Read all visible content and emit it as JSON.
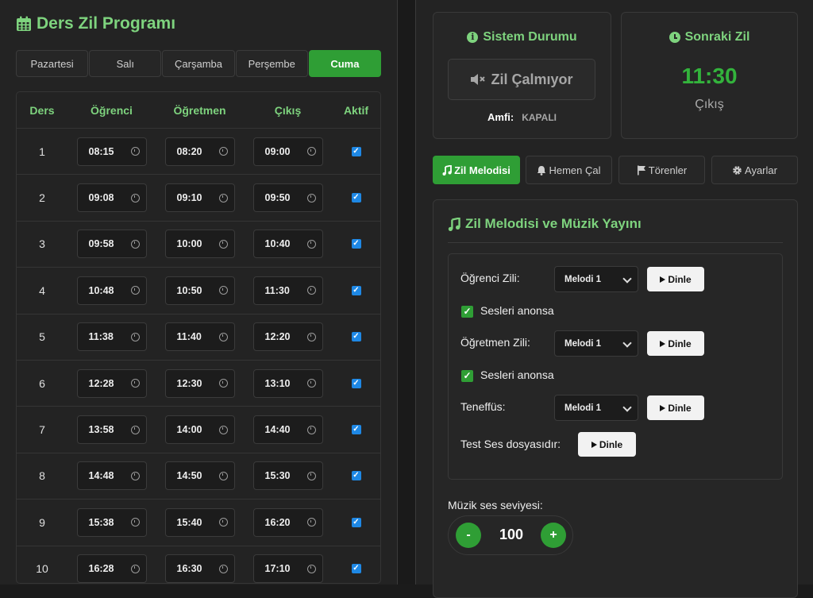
{
  "schedule": {
    "title": "Ders Zil Programı",
    "days": [
      "Pazartesi",
      "Salı",
      "Çarşamba",
      "Perşembe",
      "Cuma"
    ],
    "active_day": "Cuma",
    "columns": [
      "Ders",
      "Öğrenci",
      "Öğretmen",
      "Çıkış",
      "Aktif"
    ],
    "rows": [
      {
        "ders": "1",
        "ogrenci": "08:15",
        "ogretmen": "08:20",
        "cikis": "09:00",
        "aktif": true
      },
      {
        "ders": "2",
        "ogrenci": "09:08",
        "ogretmen": "09:10",
        "cikis": "09:50",
        "aktif": true
      },
      {
        "ders": "3",
        "ogrenci": "09:58",
        "ogretmen": "10:00",
        "cikis": "10:40",
        "aktif": true
      },
      {
        "ders": "4",
        "ogrenci": "10:48",
        "ogretmen": "10:50",
        "cikis": "11:30",
        "aktif": true
      },
      {
        "ders": "5",
        "ogrenci": "11:38",
        "ogretmen": "11:40",
        "cikis": "12:20",
        "aktif": true
      },
      {
        "ders": "6",
        "ogrenci": "12:28",
        "ogretmen": "12:30",
        "cikis": "13:10",
        "aktif": true
      },
      {
        "ders": "7",
        "ogrenci": "13:58",
        "ogretmen": "14:00",
        "cikis": "14:40",
        "aktif": true
      },
      {
        "ders": "8",
        "ogrenci": "14:48",
        "ogretmen": "14:50",
        "cikis": "15:30",
        "aktif": true
      },
      {
        "ders": "9",
        "ogrenci": "15:38",
        "ogretmen": "15:40",
        "cikis": "16:20",
        "aktif": true
      },
      {
        "ders": "10",
        "ogrenci": "16:28",
        "ogretmen": "16:30",
        "cikis": "17:10",
        "aktif": true
      }
    ]
  },
  "status": {
    "title": "Sistem Durumu",
    "bell_state": "Zil Çalmıyor",
    "amfi_label": "Amfi:",
    "amfi_value": "KAPALI"
  },
  "next_bell": {
    "title": "Sonraki Zil",
    "time": "11:30",
    "label": "Çıkış"
  },
  "nav": {
    "melody": "Zil Melodisi",
    "ring_now": "Hemen Çal",
    "ceremonies": "Törenler",
    "settings": "Ayarlar"
  },
  "melody_panel": {
    "title": "Zil Melodisi ve Müzik Yayını",
    "student_label": "Öğrenci Zili:",
    "student_melody": "Melodi 1",
    "teacher_label": "Öğretmen Zili:",
    "teacher_melody": "Melodi 1",
    "break_label": "Teneffüs:",
    "break_melody": "Melodi 1",
    "announce_label": "Sesleri anonsa",
    "test_label": "Test Ses dosyasıdır:",
    "listen": "Dinle",
    "volume_label": "Müzik ses seviyesi:",
    "volume_value": "100",
    "minus": "-",
    "plus": "+"
  },
  "colors": {
    "accent": "#2f9e35",
    "accent_text": "#7ed37e",
    "background": "#232323"
  }
}
